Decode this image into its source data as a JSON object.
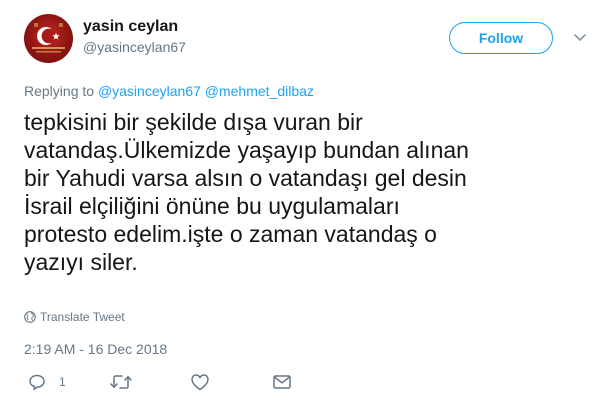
{
  "user": {
    "display_name": "yasin ceylan",
    "screen_name": "@yasinceylan67"
  },
  "follow_label": "Follow",
  "replying": {
    "prefix": "Replying to ",
    "mentions": [
      "@yasinceylan67",
      "@mehmet_dilbaz"
    ]
  },
  "tweet_lines": [
    "tepkisini bir şekilde dışa vuran bir",
    "vatandaş.Ülkemizde yaşayıp bundan alınan",
    "bir Yahudi varsa alsın o vatandaşı gel desin",
    "İsrail elçiliğini önüne bu uygulamaları",
    "protesto edelim.işte o zaman vatandaş o",
    "yazıyı siler."
  ],
  "translate_label": "Translate Tweet",
  "timestamp": "2:19 AM - 16 Dec 2018",
  "actions": {
    "reply_count": "1"
  },
  "colors": {
    "accent": "#1da1f2",
    "secondary_text": "#657786",
    "primary_text": "#14171a"
  }
}
